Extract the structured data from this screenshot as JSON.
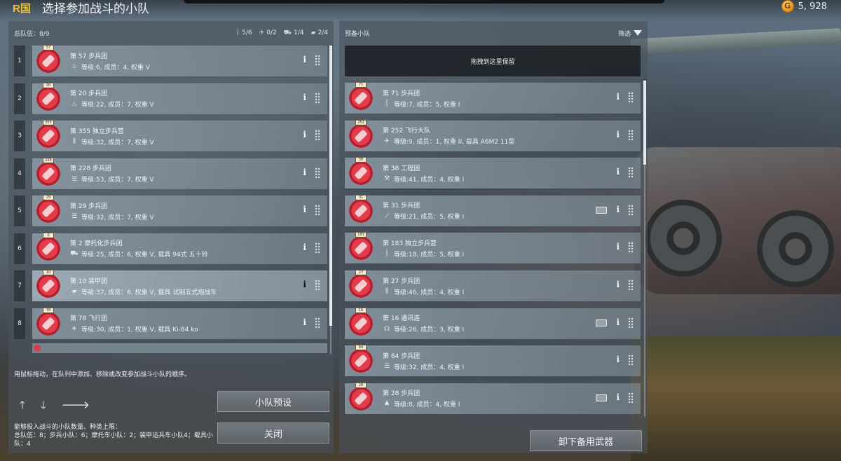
{
  "header": {
    "nation": "R国",
    "title": "选择参加战斗的小队",
    "currency_value": "5, 928"
  },
  "left_panel": {
    "title": "总队伍：8/9",
    "stats": [
      {
        "icon": "rifle-icon",
        "value": "5/6"
      },
      {
        "icon": "plane-icon",
        "value": "0/2"
      },
      {
        "icon": "vehicle-icon",
        "value": "1/4"
      },
      {
        "icon": "tank-icon",
        "value": "2/4"
      }
    ],
    "squads": [
      {
        "num": "1",
        "tag": "57",
        "name": "第 57 步兵团",
        "icon": "flame-icon",
        "info": "等级:6, 成员：4, 权重 V"
      },
      {
        "num": "2",
        "tag": "20",
        "name": "第 20 步兵团",
        "icon": "flame-icon",
        "info": "等级:22, 成员：7, 权重 V"
      },
      {
        "num": "3",
        "tag": "355",
        "name": "第 355 独立步兵营",
        "icon": "ammo-icon",
        "info": "等级:32, 成员：7, 权重 V"
      },
      {
        "num": "4",
        "tag": "228",
        "name": "第 228 步兵团",
        "icon": "list-icon",
        "info": "等级:53, 成员：7, 权重 V"
      },
      {
        "num": "5",
        "tag": "29",
        "name": "第 29 步兵团",
        "icon": "list-icon",
        "info": "等级:32, 成员：7, 权重 V"
      },
      {
        "num": "6",
        "tag": "2",
        "name": "第 2 摩托化步兵团",
        "icon": "vehicle-icon",
        "info": "等级:25, 成员：6, 权重 V, 载具 94式 五十铃"
      },
      {
        "num": "7",
        "tag": "10",
        "name": "第 10 装甲团",
        "icon": "tank-icon",
        "info": "等级:37, 成员：6, 权重 V, 载具 试制五式炮战车"
      },
      {
        "num": "8",
        "tag": "78",
        "name": "第 78 飞行团",
        "icon": "plane-icon",
        "info": "等级:30, 成员：1, 权重 V, 载具 Ki-84 ko"
      }
    ],
    "hint": "用鼠标拖动，在队列中添加、移除或改变参加战斗小队的顺序。",
    "limits_title": "能够投入战斗的小队数量、种类上限：",
    "limits_text": "总队伍：8；步兵小队：6；摩托车小队：2；装甲运兵车小队4；载具小队：4",
    "preset_button": "小队预设",
    "close_button": "关闭"
  },
  "right_panel": {
    "title": "预备小队",
    "filter_label": "筛选",
    "drop_zone": "拖拽到这里保留",
    "squads": [
      {
        "tag": "71",
        "name": "第 71 步兵团",
        "icon": "rifle-icon",
        "info": "等级:7, 成员：5, 权重 I",
        "weapons": false
      },
      {
        "tag": "252",
        "name": "第 252 飞行大队",
        "icon": "plane-icon",
        "info": "等级:9, 成员：1, 权重 II, 载具 A6M2 11型",
        "weapons": false
      },
      {
        "tag": "38",
        "name": "第 38 工程团",
        "icon": "wrench-icon",
        "info": "等级:41, 成员：4, 权重 I",
        "weapons": false
      },
      {
        "tag": "31",
        "name": "第 31 步兵团",
        "icon": "knife-icon",
        "info": "等级:21, 成员：5, 权重 I",
        "weapons": true
      },
      {
        "tag": "183",
        "name": "第 183 独立步兵营",
        "icon": "rifle-icon",
        "info": "等级:18, 成员：5, 权重 I",
        "weapons": false
      },
      {
        "tag": "27",
        "name": "第 27 步兵团",
        "icon": "ammo-icon",
        "info": "等级:46, 成员：4, 权重 I",
        "weapons": false
      },
      {
        "tag": "16",
        "name": "第 16 通讯连",
        "icon": "headset-icon",
        "info": "等级:26, 成员：3, 权重 I",
        "weapons": true
      },
      {
        "tag": "64",
        "name": "第 64 步兵团",
        "icon": "list-icon",
        "info": "等级:32, 成员：4, 权重 I",
        "weapons": false
      },
      {
        "tag": "28",
        "name": "第 28 步兵团",
        "icon": "fire-icon",
        "info": "等级:8, 成员：4, 权重 I",
        "weapons": true
      }
    ],
    "unequip_button": "卸下备用武器"
  },
  "colors": {
    "panel": "#48525c",
    "card": "#96a6b2",
    "emblem_red": "#e23c4a",
    "gold": "#f0c23a"
  }
}
